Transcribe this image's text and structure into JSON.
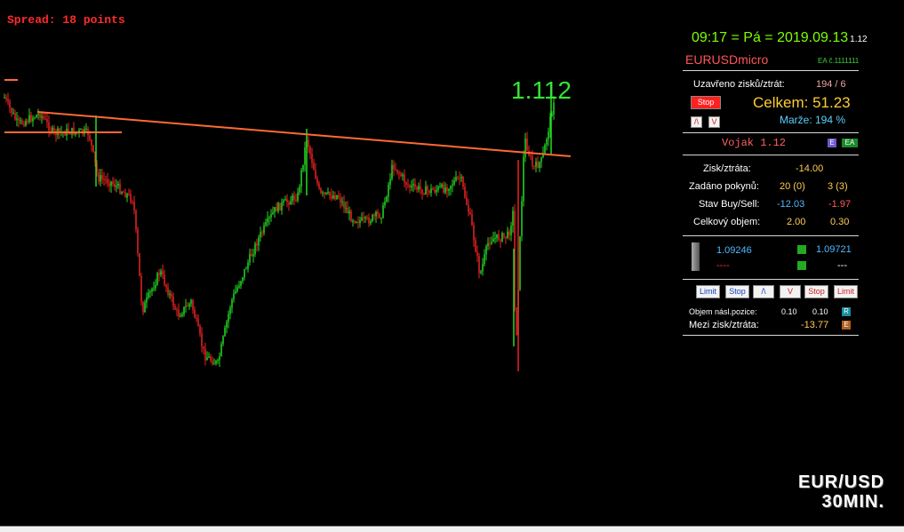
{
  "spread_label": "Spread: 18 points",
  "current_price_label": "1.112",
  "colors": {
    "bull": "#22dd22",
    "bear": "#ee2222",
    "trendline": "#ff6a33",
    "accent_green": "#7fff00"
  },
  "panel": {
    "clock": "09:17 = Pá = 2019.09.13",
    "version": "1.12",
    "symbol": "EURUSDmicro",
    "ea_number": "EA č.1111111",
    "closed_pl_label": "Uzavřeno zisků/ztrát:",
    "closed_pl_value": "194 / 6",
    "stop_button": "Stop",
    "total_label": "Celkem: 51.23",
    "buy_small": "/\\",
    "sell_small": "V",
    "margin_label": "Marže:  194 %",
    "ea_name": "Vojak 1.12",
    "e_badge": "E",
    "ea_badge": "EA",
    "profit_loss_label": "Zisk/ztráta:",
    "profit_loss_value": "-14.00",
    "orders_label": "Zadáno pokynů:",
    "orders_buy": "20 (0)",
    "orders_sell": "3 (3)",
    "state_label": "Stav Buy/Sell:",
    "state_buy": "-12.03",
    "state_sell": "-1.97",
    "volume_label": "Celkový objem:",
    "volume_buy": "2.00",
    "volume_sell": "0.30",
    "price_buy": "1.09246",
    "price_sell": "1.09721",
    "dash_buy": "----",
    "dash_sell": "---",
    "buttons": [
      "Limit",
      "Stop",
      "/\\",
      "V",
      "Stop",
      "Limit"
    ],
    "next_volume_label": "Objem násl.pozice:",
    "next_volume_a": "0.10",
    "next_volume_b": "0.10",
    "r_badge": "R",
    "interim_label": "Mezi zisk/ztráta:",
    "interim_value": "-13.77",
    "e2_badge": "E"
  },
  "watermark_line1": "EUR/USD",
  "watermark_line2": "30MIN."
}
